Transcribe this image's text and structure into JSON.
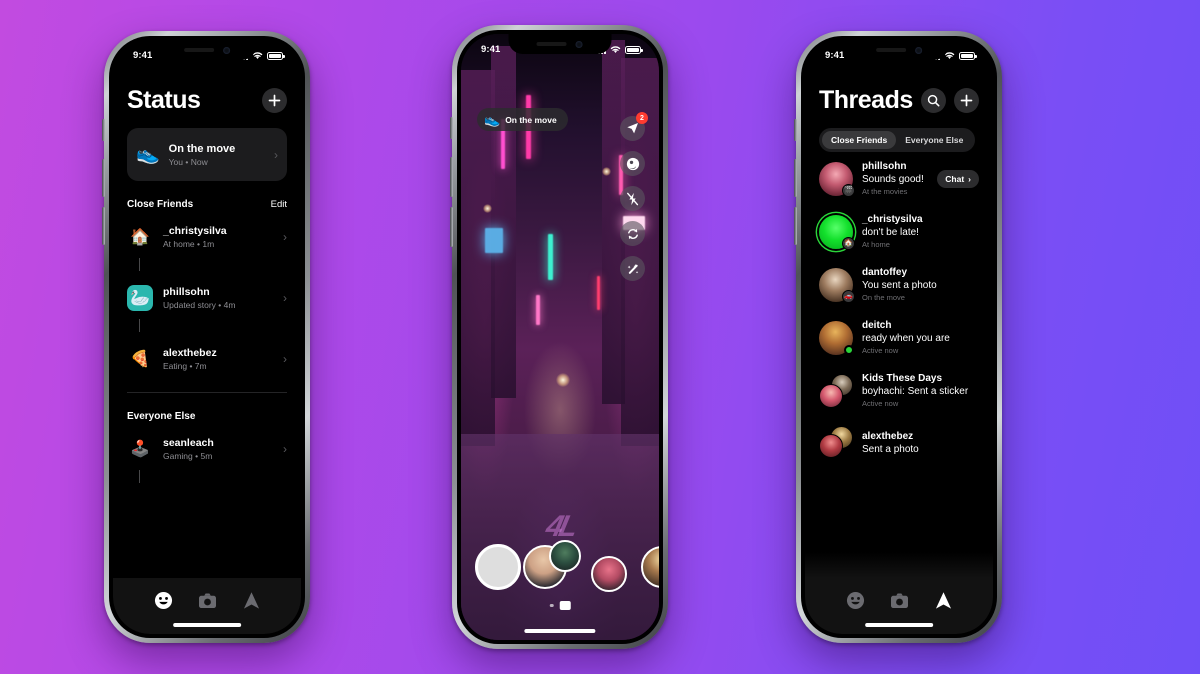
{
  "background": {
    "gradient_from": "#c24be0",
    "gradient_to": "#6f4ff7"
  },
  "status_bar": {
    "time": "9:41"
  },
  "phone1": {
    "title": "Status",
    "compose_label": "+",
    "my_status": {
      "emoji": "👟",
      "title": "On the move",
      "subtitle": "You • Now"
    },
    "sections": [
      {
        "heading": "Close Friends",
        "action": "Edit",
        "items": [
          {
            "emoji": "🏠",
            "name": "_christysilva",
            "sub": "At home • 1m"
          },
          {
            "emoji": "🦢",
            "name": "phillsohn",
            "sub": "Updated story • 4m"
          },
          {
            "emoji": "🍕",
            "name": "alexthebez",
            "sub": "Eating • 7m"
          }
        ]
      },
      {
        "heading": "Everyone Else",
        "action": "",
        "items": [
          {
            "emoji": "🕹️",
            "name": "seanleach",
            "sub": "Gaming • 5m"
          }
        ]
      }
    ],
    "tabs": [
      {
        "icon": "smiley-icon",
        "active": true
      },
      {
        "icon": "camera-icon",
        "active": false
      },
      {
        "icon": "send-icon",
        "active": false
      }
    ]
  },
  "phone2": {
    "status_pill": {
      "emoji": "👟",
      "label": "On the move"
    },
    "side_buttons": [
      {
        "icon": "send-icon",
        "badge": "2"
      },
      {
        "icon": "night-mode-icon",
        "badge": ""
      },
      {
        "icon": "flash-off-icon",
        "badge": ""
      },
      {
        "icon": "flip-camera-icon",
        "badge": ""
      },
      {
        "icon": "effects-icon",
        "badge": ""
      }
    ],
    "graffiti": "4L",
    "shutter_label": "shutter-button",
    "avatars": [
      "avatar-1",
      "avatar-2",
      "avatar-3",
      "avatar-4"
    ]
  },
  "phone3": {
    "title": "Threads",
    "search_label": "search-icon",
    "compose_label": "+",
    "segments": [
      {
        "label": "Close Friends",
        "selected": true
      },
      {
        "label": "Everyone Else",
        "selected": false
      }
    ],
    "threads": [
      {
        "name": "phillsohn",
        "message": "Sounds good!",
        "sub": "At the movies",
        "action": "Chat",
        "badge_emoji": "🎬",
        "online": false,
        "ring": false
      },
      {
        "name": "_christysilva",
        "message": "don't be late!",
        "sub": "At home",
        "action": "",
        "badge_emoji": "🏠",
        "online": false,
        "ring": true
      },
      {
        "name": "dantoffey",
        "message": "You sent a photo",
        "sub": "On the move",
        "action": "",
        "badge_emoji": "🚗",
        "online": false,
        "ring": false
      },
      {
        "name": "deitch",
        "message": "ready when you are",
        "sub": "Active now",
        "action": "",
        "badge_emoji": "",
        "online": true,
        "ring": false
      },
      {
        "name": "Kids These Days",
        "message": "boyhachi: Sent a sticker",
        "sub": "Active now",
        "action": "",
        "badge_emoji": "",
        "online": true,
        "ring": false
      },
      {
        "name": "alexthebez",
        "message": "Sent a photo",
        "sub": "",
        "action": "",
        "badge_emoji": "",
        "online": false,
        "ring": false
      }
    ],
    "tabs": [
      {
        "icon": "smiley-icon",
        "active": false
      },
      {
        "icon": "camera-icon",
        "active": false
      },
      {
        "icon": "send-icon",
        "active": true
      }
    ]
  }
}
